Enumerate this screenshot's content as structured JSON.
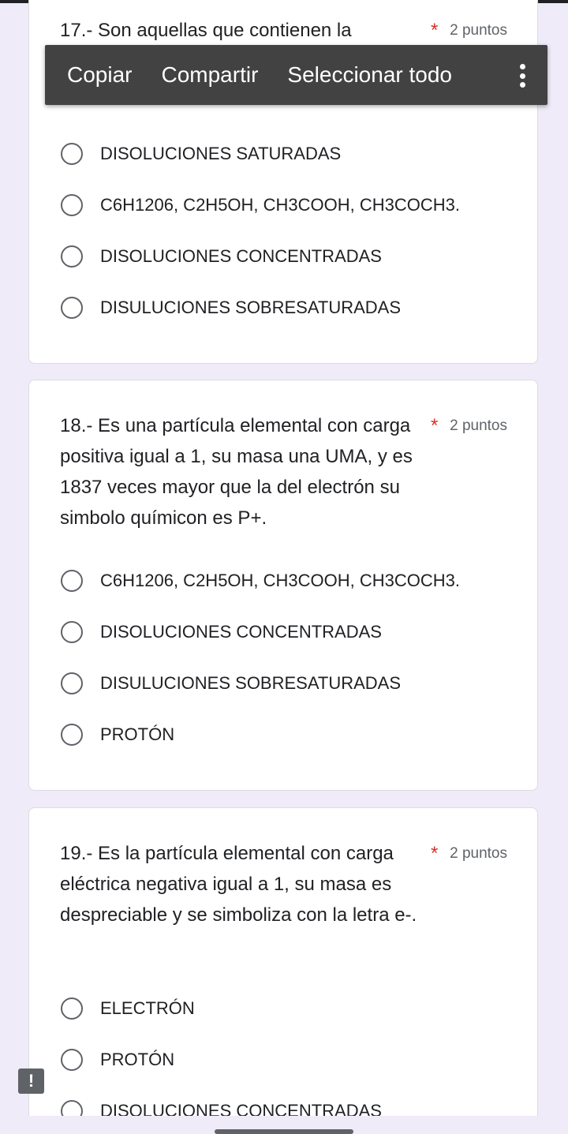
{
  "context_menu": {
    "copy": "Copiar",
    "share": "Compartir",
    "select_all": "Seleccionar todo"
  },
  "questions": [
    {
      "title": "17.- Son aquellas que contienen la",
      "required_mark": "*",
      "points": "2 puntos",
      "options": [
        "DISOLUCIONES SATURADAS",
        "C6H1206, C2H5OH, CH3COOH, CH3COCH3.",
        "DISOLUCIONES CONCENTRADAS",
        "DISULUCIONES SOBRESATURADAS"
      ]
    },
    {
      "title": "18.- Es una partícula elemental con carga positiva igual a 1, su masa una UMA, y es 1837 veces mayor que la del electrón su simbolo químicon es P+.",
      "required_mark": "*",
      "points": "2 puntos",
      "options": [
        "C6H1206, C2H5OH, CH3COOH, CH3COCH3.",
        "DISOLUCIONES CONCENTRADAS",
        "DISULUCIONES SOBRESATURADAS",
        "PROTÓN"
      ]
    },
    {
      "title": "19.- Es la partícula elemental con carga eléctrica negativa igual a 1, su masa es despreciable y se simboliza con la letra e-.",
      "required_mark": "*",
      "points": "2 puntos",
      "options": [
        "ELECTRÓN",
        "PROTÓN",
        "DISOLUCIONES CONCENTRADAS"
      ]
    }
  ],
  "alert_badge": "!",
  "colors": {
    "background": "#f0ebf8",
    "card": "#ffffff",
    "required": "#d93025",
    "menu": "#424242"
  }
}
